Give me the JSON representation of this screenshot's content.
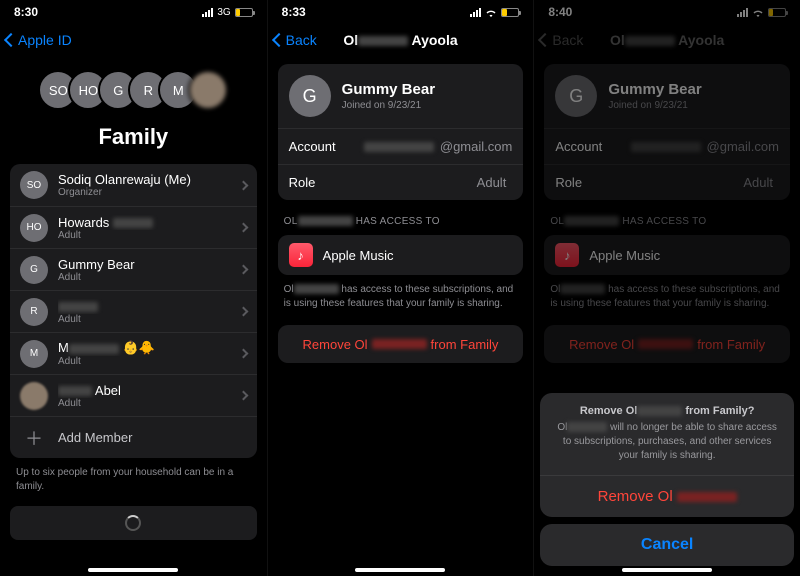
{
  "p1": {
    "status": {
      "time": "8:30",
      "net": "3G"
    },
    "back": "Apple ID",
    "title": "Family",
    "avatars": [
      "SO",
      "HO",
      "G",
      "R",
      "M"
    ],
    "members": [
      {
        "initials": "SO",
        "name": "Sodiq Olanrewaju (Me)",
        "sub": "Organizer"
      },
      {
        "initials": "HO",
        "name": "Howards ▇▇▇▇",
        "sub": "Adult"
      },
      {
        "initials": "G",
        "name": "Gummy Bear",
        "sub": "Adult"
      },
      {
        "initials": "R",
        "name": "▇▇▇▇▇",
        "sub": "Adult"
      },
      {
        "initials": "M",
        "name": "M▇▇▇▇▇ 👶🐥",
        "sub": "Adult"
      },
      {
        "initials": "",
        "name": "▇▇▇▇ Abel",
        "sub": "Adult",
        "photo": true
      }
    ],
    "add": "Add Member",
    "footnote": "Up to six people from your household can be in a family."
  },
  "p2": {
    "status": {
      "time": "8:33"
    },
    "back": "Back",
    "title_prefix": "Ol",
    "title_suffix": "Ayoola",
    "member": {
      "initial": "G",
      "name": "Gummy Bear",
      "joined": "Joined on 9/23/21"
    },
    "account_label": "Account",
    "account_suffix": "@gmail.com",
    "role_label": "Role",
    "role_value": "Adult",
    "access_prefix": "OL",
    "access_suffix": " HAS ACCESS TO",
    "app": "Apple Music",
    "explain_prefix": "Ol",
    "explain_suffix": " has access to these subscriptions, and is using these features that your family is sharing.",
    "remove_prefix": "Remove Ol",
    "remove_suffix": " from Family"
  },
  "p3": {
    "status": {
      "time": "8:40"
    },
    "back": "Back",
    "sheet": {
      "title_prefix": "Remove Ol",
      "title_suffix": " from Family?",
      "desc_prefix": "Ol",
      "desc_suffix": " will no longer be able to share access to subscriptions, purchases, and other services your family is sharing.",
      "action_prefix": "Remove Ol",
      "cancel": "Cancel"
    }
  }
}
